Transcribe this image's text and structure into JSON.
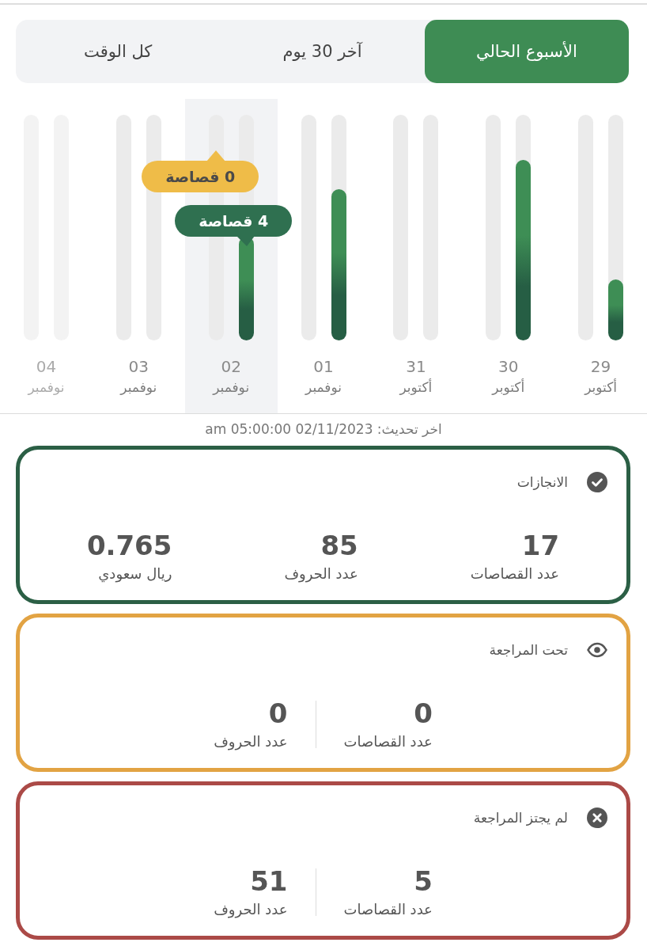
{
  "tabs": [
    {
      "label": "الأسبوع الحالي",
      "selected": true
    },
    {
      "label": "آخر 30 يوم",
      "selected": false
    },
    {
      "label": "كل الوقت",
      "selected": false
    }
  ],
  "chart": {
    "days": [
      {
        "day": "29",
        "month": "أكتوبر",
        "selected": false,
        "disabled": false,
        "bars": [
          {
            "kind": "review"
          },
          {
            "kind": "approved",
            "level": 0.27
          }
        ]
      },
      {
        "day": "30",
        "month": "أكتوبر",
        "selected": false,
        "disabled": false,
        "bars": [
          {
            "kind": "review"
          },
          {
            "kind": "approved",
            "level": 0.8
          }
        ]
      },
      {
        "day": "31",
        "month": "أكتوبر",
        "selected": false,
        "disabled": false,
        "bars": [
          {
            "kind": "review"
          },
          {
            "kind": "approved"
          }
        ]
      },
      {
        "day": "01",
        "month": "نوفمبر",
        "selected": false,
        "disabled": false,
        "bars": [
          {
            "kind": "review"
          },
          {
            "kind": "approved",
            "level": 0.67
          }
        ]
      },
      {
        "day": "02",
        "month": "نوفمبر",
        "selected": true,
        "disabled": false,
        "bars": [
          {
            "kind": "review",
            "tooltip": "0 قصاصة"
          },
          {
            "kind": "approved",
            "level": 0.46,
            "tooltip": "4 قصاصة"
          }
        ]
      },
      {
        "day": "03",
        "month": "نوفمبر",
        "selected": false,
        "disabled": false,
        "bars": [
          {
            "kind": "review"
          },
          {
            "kind": "approved"
          }
        ]
      },
      {
        "day": "04",
        "month": "نوفمبر",
        "selected": false,
        "disabled": true,
        "bars": [
          {
            "kind": "review"
          },
          {
            "kind": "approved"
          }
        ]
      }
    ]
  },
  "last_update": "اخر تحديث: 02/11/2023 05:00:00 am",
  "cards": [
    {
      "kind": "achieved",
      "title": "الانجازات",
      "color": "#2b5f45",
      "stats": [
        {
          "value": "17",
          "label": "عدد القصاصات"
        },
        {
          "value": "85",
          "label": "عدد الحروف"
        },
        {
          "value": "0.765",
          "label": "ريال سعودي"
        }
      ]
    },
    {
      "kind": "in_review",
      "title": "تحت المراجعة",
      "color": "#e2a343",
      "stats": [
        {
          "value": "0",
          "label": "عدد القصاصات"
        },
        {
          "value": "0",
          "label": "عدد الحروف"
        }
      ]
    },
    {
      "kind": "rejected",
      "title": "لم يجتز المراجعة",
      "color": "#ab4a47",
      "stats": [
        {
          "value": "5",
          "label": "عدد القصاصات"
        },
        {
          "value": "51",
          "label": "عدد الحروف"
        }
      ]
    }
  ]
}
